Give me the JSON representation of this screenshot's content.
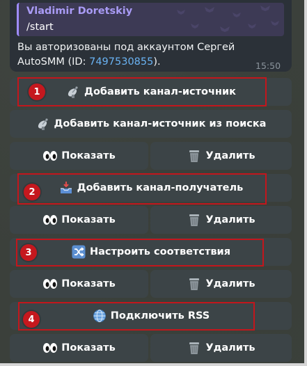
{
  "message": {
    "reply_name": "Vladimir Doretskiy",
    "reply_text": "/start",
    "text_line1": "Вы авторизованы под аккаунтом Сергей",
    "text_line2_prefix": "AutoSMM (ID: ",
    "id_value": "7497530855",
    "text_line2_suffix": ").",
    "time": "15:50"
  },
  "keyboard": {
    "add_source": "Добавить канал-источник",
    "add_source_search": "Добавить канал-источник из поиска",
    "show_1": "Показать",
    "delete_1": "Удалить",
    "add_target": "Добавить канал-получатель",
    "show_2": "Показать",
    "delete_2": "Удалить",
    "setup_mapping": "Настроить соответствия",
    "show_3": "Показать",
    "delete_3": "Удалить",
    "connect_rss": "Подключить RSS",
    "show_4": "Показать",
    "delete_4": "Удалить"
  },
  "annotations": {
    "badge_1": "1",
    "badge_2": "2",
    "badge_3": "3",
    "badge_4": "4",
    "highlight_color": "#c3161c"
  },
  "icons": {
    "satellite": "satellite-antenna-icon",
    "eyes": "eyes-icon",
    "trash": "wastebasket-icon",
    "inbox": "inbox-tray-icon",
    "shuffle": "shuffle-icon",
    "globe": "globe-icon"
  }
}
